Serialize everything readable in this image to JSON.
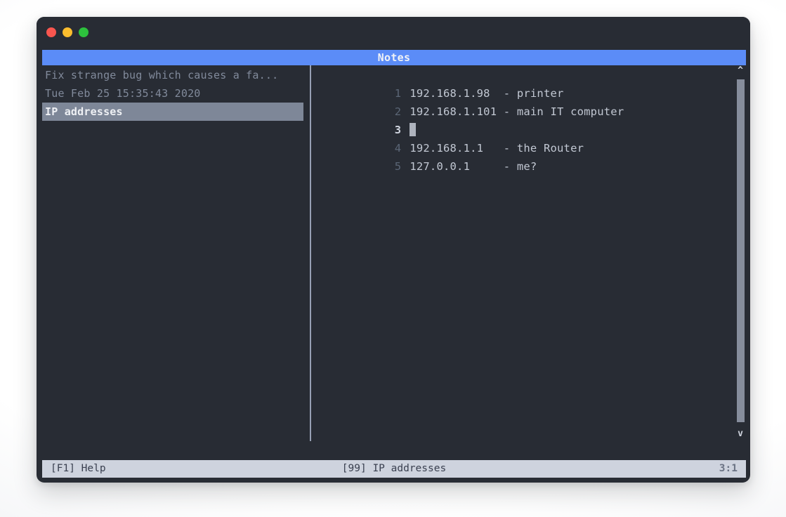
{
  "window": {
    "title": "Notes",
    "traffic_lights": [
      {
        "name": "close",
        "color": "#f9564f"
      },
      {
        "name": "minimize",
        "color": "#fbbd2e"
      },
      {
        "name": "maximize",
        "color": "#2dc13d"
      }
    ]
  },
  "header": {
    "title": "Notes",
    "background": "#5b8cf7",
    "text_color": "#f0f2f6"
  },
  "sidebar": {
    "notes": [
      {
        "label": "Fix strange bug which causes a fa...",
        "selected": false
      },
      {
        "label": "Tue Feb 25 15:35:43 2020",
        "selected": false
      },
      {
        "label": "IP addresses",
        "selected": true
      }
    ],
    "selected_background": "#7e8798"
  },
  "editor": {
    "lines": [
      {
        "number": "1",
        "text": "192.168.1.98  - printer",
        "current": false,
        "cursor": false
      },
      {
        "number": "2",
        "text": "192.168.1.101 - main IT computer",
        "current": false,
        "cursor": false
      },
      {
        "number": "3",
        "text": "",
        "current": true,
        "cursor": true
      },
      {
        "number": "4",
        "text": "192.168.1.1   - the Router",
        "current": false,
        "cursor": false
      },
      {
        "number": "5",
        "text": "127.0.0.1     - me?",
        "current": false,
        "cursor": false
      }
    ]
  },
  "scrollbar": {
    "up_arrow": "^",
    "down_arrow": "v"
  },
  "statusbar": {
    "help": "[F1] Help",
    "document": "[99] IP addresses",
    "position": "3:1"
  }
}
